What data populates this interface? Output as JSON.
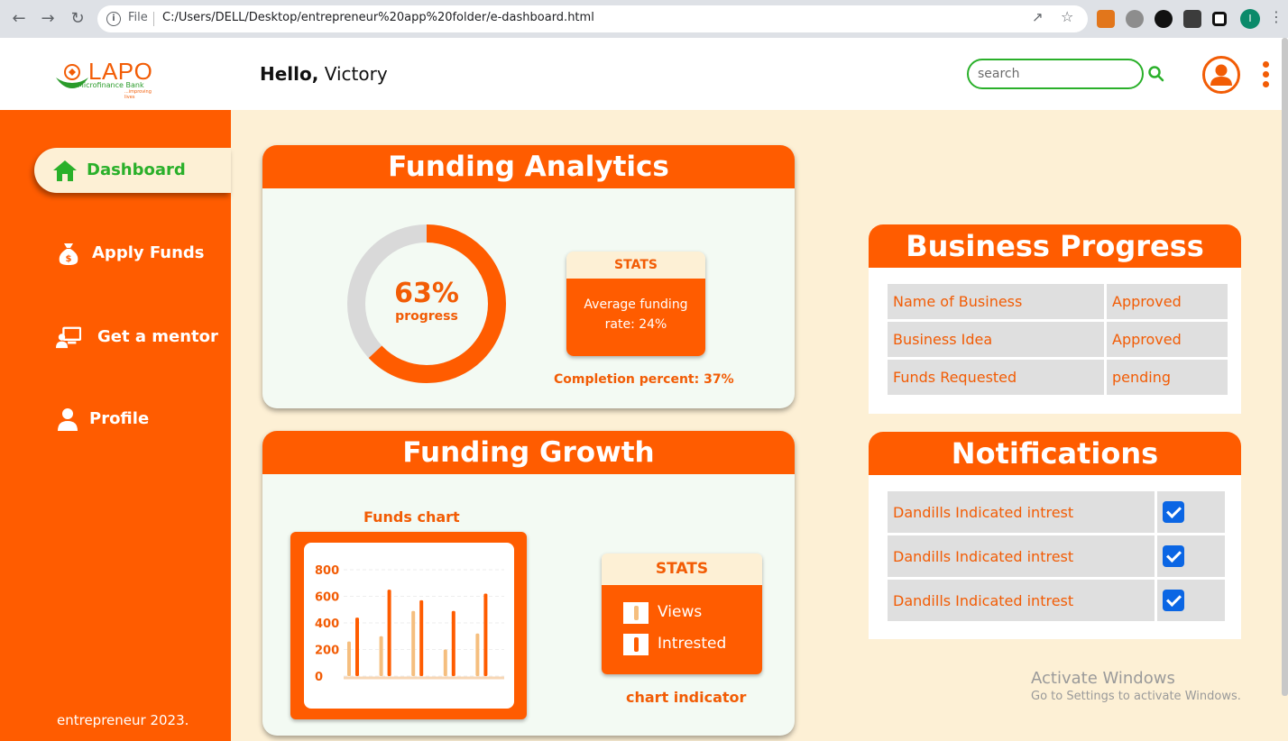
{
  "browser": {
    "file_label": "File",
    "url": "C:/Users/DELL/Desktop/entrepreneur%20app%20folder/e-dashboard.html",
    "profile_initial": "I"
  },
  "header": {
    "logo_text": "LAPO",
    "logo_sub": "Microfinance Bank",
    "logo_tag": "...improving lives",
    "greeting_bold": "Hello,",
    "greeting_name": "Victory",
    "search_placeholder": "search"
  },
  "sidebar": {
    "items": [
      {
        "label": "Dashboard",
        "icon": "home-icon",
        "active": true
      },
      {
        "label": "Apply Funds",
        "icon": "money-bag-icon"
      },
      {
        "label": "Get a mentor",
        "icon": "mentor-icon"
      },
      {
        "label": "Profile",
        "icon": "user-icon"
      }
    ],
    "footer": "entrepreneur 2023."
  },
  "funding_analytics": {
    "title": "Funding Analytics",
    "progress_value": 63,
    "progress_percent": "63%",
    "progress_label": "progress",
    "stats_title": "STATS",
    "stats_text": "Average funding rate: 24%",
    "completion": "Completion percent: 37%"
  },
  "funding_growth": {
    "title": "Funding Growth",
    "chart_title": "Funds chart",
    "stats_title": "STATS",
    "legend": [
      {
        "label": "Views",
        "color": "#f5be7e"
      },
      {
        "label": "Intrested",
        "color": "#ff5c00"
      }
    ],
    "chart_indicator": "chart indicator"
  },
  "chart_data": {
    "type": "bar",
    "title": "Funds chart",
    "yticks": [
      "800",
      "600",
      "400",
      "200",
      "0"
    ],
    "ylim": [
      0,
      800
    ],
    "grid": true,
    "series": [
      {
        "name": "Views",
        "color": "#f5be7e",
        "values": [
          260,
          300,
          490,
          200,
          320
        ]
      },
      {
        "name": "Intrested",
        "color": "#ff5c00",
        "values": [
          440,
          650,
          570,
          490,
          620
        ]
      }
    ]
  },
  "business_progress": {
    "title": "Business Progress",
    "rows": [
      {
        "name": "Name of Business",
        "status": "Approved"
      },
      {
        "name": "Business Idea",
        "status": "Approved"
      },
      {
        "name": "Funds Requested",
        "status": "pending"
      }
    ]
  },
  "notifications": {
    "title": "Notifications",
    "items": [
      {
        "text": "Dandills Indicated intrest",
        "checked": true
      },
      {
        "text": "Dandills Indicated intrest",
        "checked": true
      },
      {
        "text": "Dandills Indicated intrest",
        "checked": true
      }
    ]
  },
  "watermark": {
    "line1": "Activate Windows",
    "line2": "Go to Settings to activate Windows."
  },
  "colors": {
    "accent": "#ff5c00",
    "green": "#2ab02a",
    "cream": "#fdf0d5"
  }
}
